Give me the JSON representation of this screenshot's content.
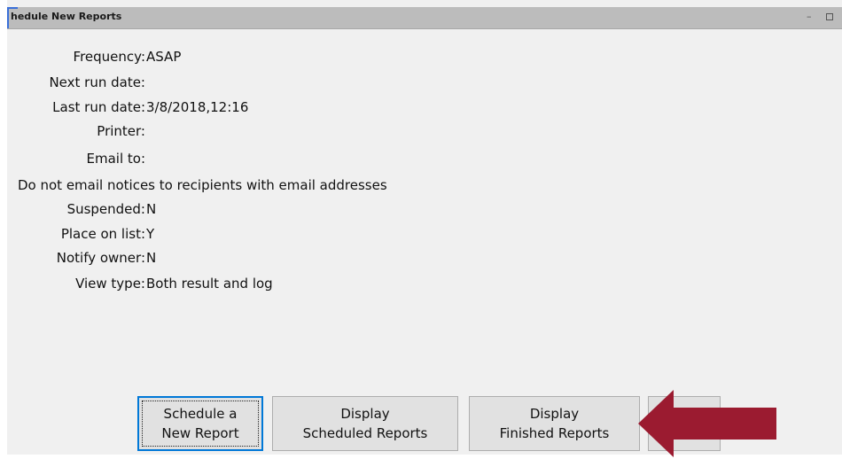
{
  "window": {
    "title": "hedule New Reports"
  },
  "fields": {
    "frequency": {
      "label": "Frequency:",
      "value": "ASAP"
    },
    "next_run": {
      "label": "Next run date:",
      "value": ""
    },
    "last_run": {
      "label": "Last run date:",
      "value": "3/8/2018,12:16"
    },
    "printer": {
      "label": "Printer:",
      "value": ""
    },
    "email_to": {
      "label": "Email to:",
      "value": ""
    },
    "email_notice": "Do not email notices to recipients with email addresses",
    "suspended": {
      "label": "Suspended:",
      "value": "N"
    },
    "place_on_list": {
      "label": "Place on list:",
      "value": "Y"
    },
    "notify_owner": {
      "label": "Notify owner:",
      "value": "N"
    },
    "view_type": {
      "label": "View type:",
      "value": "Both result and log"
    }
  },
  "buttons": {
    "schedule_new": {
      "line1": "Schedule a",
      "line2": "New Report"
    },
    "display_scheduled": {
      "line1": "Display",
      "line2": "Scheduled Reports"
    },
    "display_finished": {
      "line1": "Display",
      "line2": "Finished Reports"
    }
  },
  "colors": {
    "arrow": "#9b1b30",
    "focus_border": "#0078d7",
    "titlebar": "#bcbcbc"
  },
  "icons": {
    "annotation": "arrow-left-icon",
    "minimize": "minimize-icon",
    "maximize": "maximize-icon"
  }
}
